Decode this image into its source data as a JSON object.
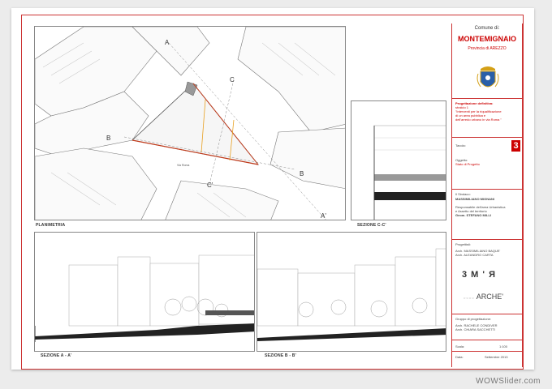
{
  "sidebar": {
    "comune_label": "Comune di:",
    "comune_name": "MONTEMIGNAIO",
    "province": "Provincia di AREZZO",
    "project_heading": "Progettazione definitiva:",
    "project_stralcio": "stralcio 1",
    "project_desc_1": "\"Interventi per la riqualificazione",
    "project_desc_2": "di un area pubblica e",
    "project_desc_3": "dell'arredo urbano in via Roma \"",
    "tavola_label": "Tavola:",
    "tavola_number": "3",
    "oggetto_label": "Oggetto:",
    "oggetto_value": "Stato di Progetto",
    "sindaco_label": "Il Sindaco:",
    "sindaco_name": "MASSIMILIANO MIGNANI",
    "resp_label_1": "Responsabile dell'area Urbanistica",
    "resp_label_2": "e Assetto del territorio",
    "resp_name": "Geom. STEFANO MILLI",
    "progettisti_label": "Progettisti:",
    "progettista_1": "Arch. MASSIMILIANO BAQUE'",
    "progettista_2": "Arch. ALEANDRO CARTA",
    "logo_1": "3 M ' Я",
    "logo_2": "ARCHE'",
    "gruppo_label": "Gruppo di progettazione:",
    "gruppo_1": "Arch. RACHELE CONDIVER",
    "gruppo_2": "Arch. CHIARA SACCHETTI",
    "scala_label": "Scala:",
    "scala_value": "1:100",
    "data_label": "Data:",
    "data_value": "Settembre 2013"
  },
  "drawing": {
    "planimetria_label": "PLANIMETRIA",
    "sezione_cc_label": "SEZIONE C-C'",
    "sezione_aa_label": "SEZIONE A - A'",
    "sezione_bb_label": "SEZIONE B - B'",
    "via_roma": "Via Roma",
    "mark_a": "A",
    "mark_a_prime": "A'",
    "mark_b": "B",
    "mark_b_prime": "B",
    "mark_c": "C",
    "mark_c_prime": "C'"
  },
  "watermark": "WOWSlider.com",
  "colors": {
    "frame_red": "#cc3333",
    "section_red": "#c03a1a",
    "accent_orange": "#e8a020",
    "tavola_red": "#c00000"
  }
}
